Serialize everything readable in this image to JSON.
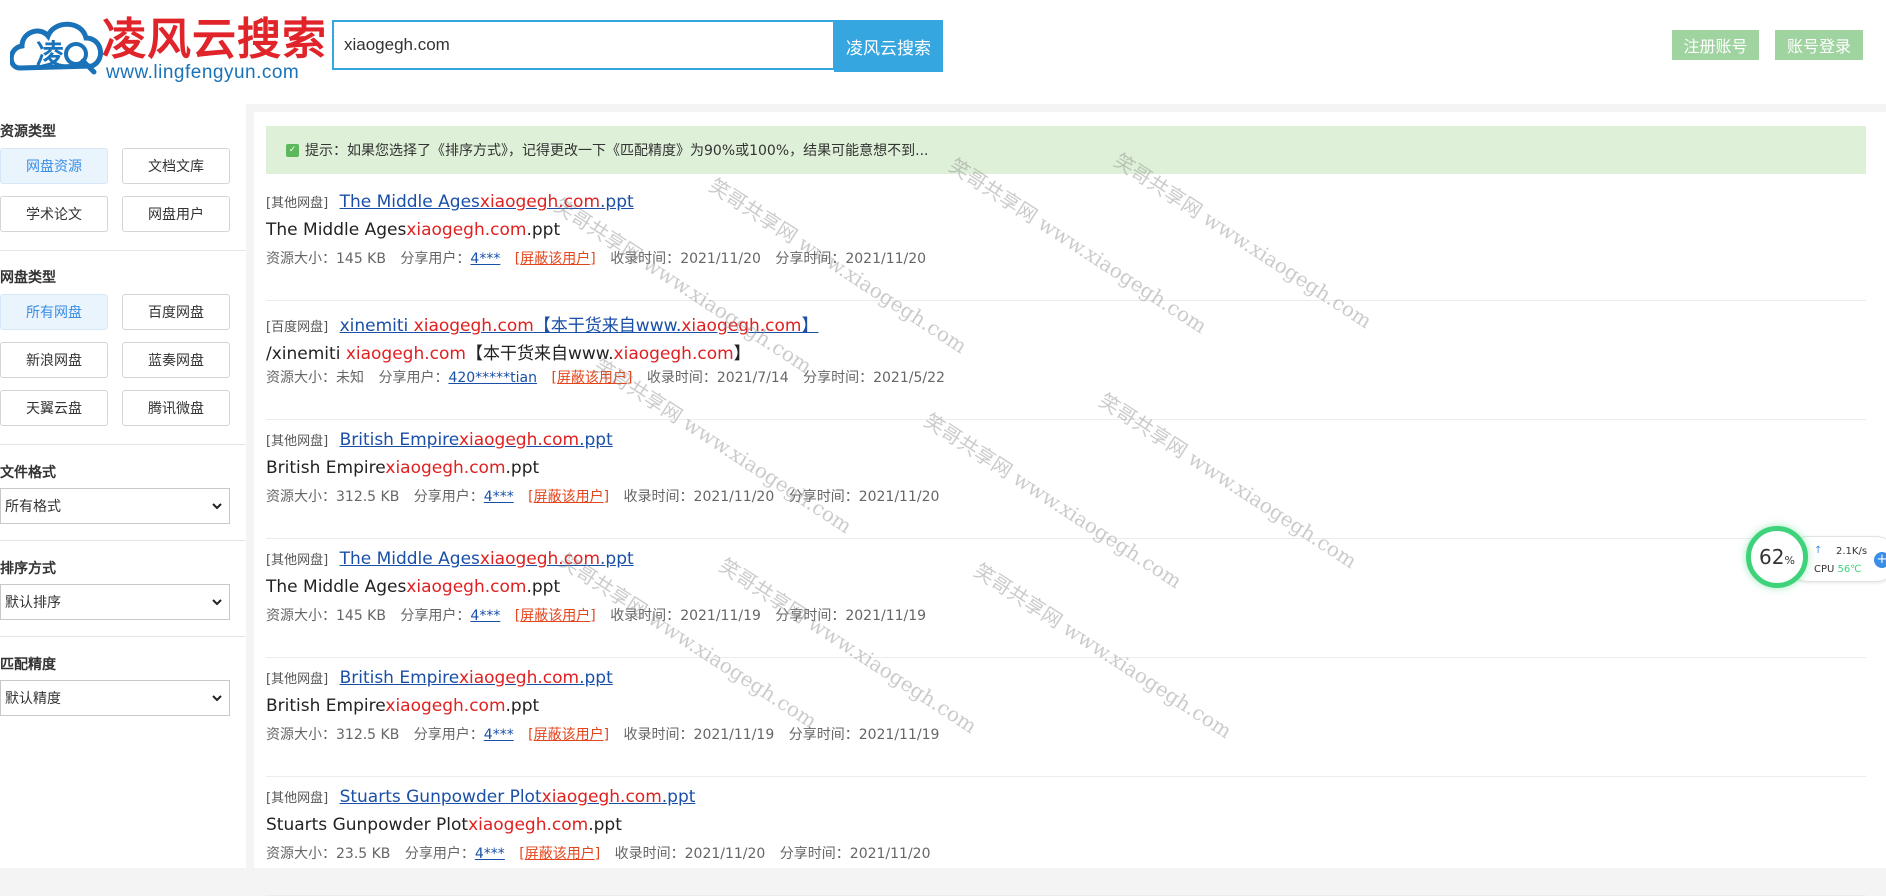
{
  "header": {
    "logo_text": "凌风云搜索",
    "logo_domain": "www.lingfengyun.com",
    "logo_glyph": "凌",
    "search_value": "xiaogegh.com",
    "search_button": "凌风云搜索",
    "register": "注册账号",
    "login": "账号登录"
  },
  "sidebar": {
    "resource_type_title": "资源类型",
    "resource_types": [
      "网盘资源",
      "文档文库",
      "学术论文",
      "网盘用户"
    ],
    "disk_type_title": "网盘类型",
    "disk_types": [
      "所有网盘",
      "百度网盘",
      "新浪网盘",
      "蓝奏网盘",
      "天翼云盘",
      "腾讯微盘"
    ],
    "format_title": "文件格式",
    "format_value": "所有格式",
    "sort_title": "排序方式",
    "sort_value": "默认排序",
    "precision_title": "匹配精度",
    "precision_value": "默认精度"
  },
  "tip": {
    "icon": "tip-icon",
    "text": "提示：如果您选择了《排序方式》，记得更改一下《匹配精度》为90%或100%，结果可能意想不到..."
  },
  "results": [
    {
      "type": "[其他网盘]",
      "title_pre": "The Middle Ages",
      "title_hl": "xiaogegh.com",
      "title_post": ".ppt",
      "name_pre": "The Middle Ages",
      "name_hl": "xiaogegh.com",
      "name_post": ".ppt",
      "size_label": "资源大小：",
      "size": "145 KB",
      "user_label": "分享用户：",
      "user": "4***",
      "block": "屏蔽该用户",
      "collect_label": "收录时间：",
      "collect": "2021/11/20",
      "share_label": "分享时间：",
      "share": "2021/11/20"
    },
    {
      "type": "[百度网盘]",
      "title_pre": "xinemiti ",
      "title_hl": "xiaogegh.com",
      "title_post": "【本干货来自www.",
      "title_hl2": "xiaogegh.com",
      "title_post2": "】",
      "name_pre": "/xinemiti ",
      "name_hl": "xiaogegh.com",
      "name_post": "【本干货来自www.",
      "name_hl2": "xiaogegh.com",
      "name_post2": "】",
      "size_label": "资源大小：",
      "size": "未知",
      "user_label": "分享用户：",
      "user": "420*****tian",
      "block": "屏蔽该用户",
      "collect_label": "收录时间：",
      "collect": "2021/7/14",
      "share_label": "分享时间：",
      "share": "2021/5/22"
    },
    {
      "type": "[其他网盘]",
      "title_pre": "British Empire",
      "title_hl": "xiaogegh.com",
      "title_post": ".ppt",
      "name_pre": "British Empire",
      "name_hl": "xiaogegh.com",
      "name_post": ".ppt",
      "size_label": "资源大小：",
      "size": "312.5 KB",
      "user_label": "分享用户：",
      "user": "4***",
      "block": "屏蔽该用户",
      "collect_label": "收录时间：",
      "collect": "2021/11/20",
      "share_label": "分享时间：",
      "share": "2021/11/20"
    },
    {
      "type": "[其他网盘]",
      "title_pre": "The Middle Ages",
      "title_hl": "xiaogegh.com",
      "title_post": ".ppt",
      "name_pre": "The Middle Ages",
      "name_hl": "xiaogegh.com",
      "name_post": ".ppt",
      "size_label": "资源大小：",
      "size": "145 KB",
      "user_label": "分享用户：",
      "user": "4***",
      "block": "屏蔽该用户",
      "collect_label": "收录时间：",
      "collect": "2021/11/19",
      "share_label": "分享时间：",
      "share": "2021/11/19"
    },
    {
      "type": "[其他网盘]",
      "title_pre": "British Empire",
      "title_hl": "xiaogegh.com",
      "title_post": ".ppt",
      "name_pre": "British Empire",
      "name_hl": "xiaogegh.com",
      "name_post": ".ppt",
      "size_label": "资源大小：",
      "size": "312.5 KB",
      "user_label": "分享用户：",
      "user": "4***",
      "block": "屏蔽该用户",
      "collect_label": "收录时间：",
      "collect": "2021/11/19",
      "share_label": "分享时间：",
      "share": "2021/11/19"
    },
    {
      "type": "[其他网盘]",
      "title_pre": "Stuarts Gunpowder Plot",
      "title_hl": "xiaogegh.com",
      "title_post": ".ppt",
      "name_pre": "Stuarts Gunpowder Plot",
      "name_hl": "xiaogegh.com",
      "name_post": ".ppt",
      "size_label": "资源大小：",
      "size": "23.5 KB",
      "user_label": "分享用户：",
      "user": "4***",
      "block": "屏蔽该用户",
      "collect_label": "收录时间：",
      "collect": "2021/11/20",
      "share_label": "分享时间：",
      "share": "2021/11/20"
    }
  ],
  "watermark": "笑哥共享网 www.xiaogegh.com",
  "cpu_widget": {
    "percent": "62",
    "percent_unit": "%",
    "speed": "2.1K/s",
    "speed_arrow": "↑",
    "cpu_label": "CPU",
    "temp": "56℃",
    "plus": "+"
  }
}
